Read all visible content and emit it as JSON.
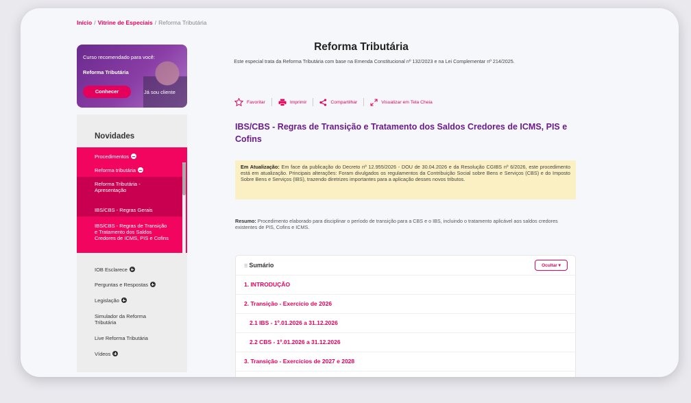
{
  "breadcrumb": {
    "home": "Início",
    "vitrine": "Vitrine de Especiais",
    "current": "Reforma Tributária",
    "sep": "/"
  },
  "promo": {
    "label": "Curso recomendado para você:",
    "title": "Reforma Tributária",
    "button": "Conhecer",
    "client": "Já sou cliente"
  },
  "sidebar": {
    "heading": "Novidades",
    "procedimentos": "Procedimentos",
    "reforma": "Reforma tributária",
    "apresentacao": "Reforma Tributária - Apresentação",
    "regras_gerais": "IBS/CBS - Regras Gerais",
    "regras_transicao": "IBS/CBS - Regras de Transição e Tratamento dos Saldos Credores de ICMS, PIS e Cofins",
    "iob": "IOB Esclarece",
    "perguntas": "Perguntas e Respostas",
    "legislacao": "Legislação",
    "simulador": "Simulador da Reforma Tributária",
    "live": "Live Reforma Tributária",
    "videos": "Vídeos"
  },
  "page": {
    "title": "Reforma Tributária",
    "subtitle": "Este especial trata da Reforma Tributária com base na Emenda Constitucional nº 132/2023 e na Lei Complementar nº 214/2025."
  },
  "actions": {
    "favoritar": "Favoritar",
    "imprimir": "Imprimir",
    "compartilhar": "Compartilhar",
    "tela_cheia": "Visualizar em Tela Cheia"
  },
  "article": {
    "heading": "IBS/CBS - Regras de Transição e Tratamento dos Saldos Credores de ICMS, PIS e Cofins",
    "alert_label": "Em Atualização:",
    "alert_text": "Em face da publicação do Decreto nº 12.955/2026 - DOU de 30.04.2026 e da Resolução CGIBS nº 6/2026, este procedimento está em atualização. Principais alterações: Foram divulgados os regulamentos da Contribuição Social sobre Bens e Serviços (CBS) e do Imposto Sobre Bens e Serviços (IBS), trazendo diretrizes importantes para a aplicação desses novos tributos.",
    "resumo_label": "Resumo:",
    "resumo_text": "Procedimento elaborado para disciplinar o período de transição para a CBS e o IBS, incluindo o tratamento aplicável aos saldos credores existentes de PIS, Cofins e ICMS."
  },
  "summary": {
    "title": "Sumário",
    "hide": "Ocultar",
    "items": [
      "1. INTRODUÇÃO",
      "2. Transição - Exercício de 2026",
      "2.1 IBS - 1º.01.2026 a 31.12.2026",
      "2.2 CBS - 1º.01.2026 a 31.12.2026",
      "3. Transição - Exercícios de 2027 e 2028"
    ]
  },
  "colors": {
    "accent": "#e5005b",
    "purple": "#6a1b8a",
    "alert_bg": "#faf0c3"
  }
}
